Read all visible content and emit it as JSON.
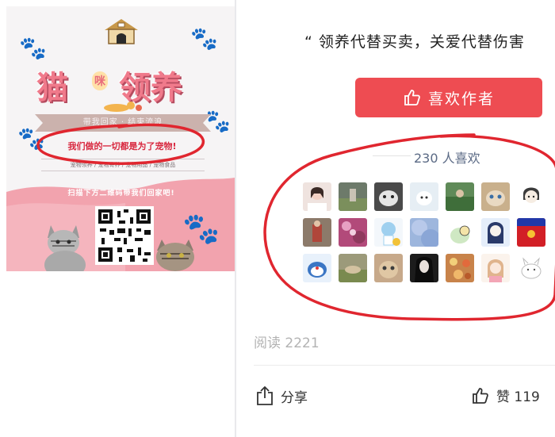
{
  "poster": {
    "title_big_1": "猫",
    "title_small": "咪",
    "title_big_2": "领养",
    "ribbon_text": "带我回家  ·  结束流浪",
    "slogan": "我们做的一切都是为了宠物!",
    "services": "宠物领养 / 宠物寄养 / 宠物用品 / 宠物食品",
    "scan_text": "扫描下方二维码带我们回家吧!",
    "icons": [
      "house-logo",
      "paw-print",
      "cat-photo",
      "qr-code"
    ]
  },
  "article": {
    "quote": "“ 领养代替买卖，关爱代替伤害",
    "like_author_label": "喜欢作者",
    "likes_count": "230 人喜欢",
    "read_count": "阅读 2221",
    "share_label": "分享",
    "praise_label": "赞 119"
  },
  "colors": {
    "accent_red": "#ee4c52",
    "poster_pink": "#f2a3ae",
    "marker_red": "#e0262f",
    "likes_text": "#5b6a85"
  }
}
